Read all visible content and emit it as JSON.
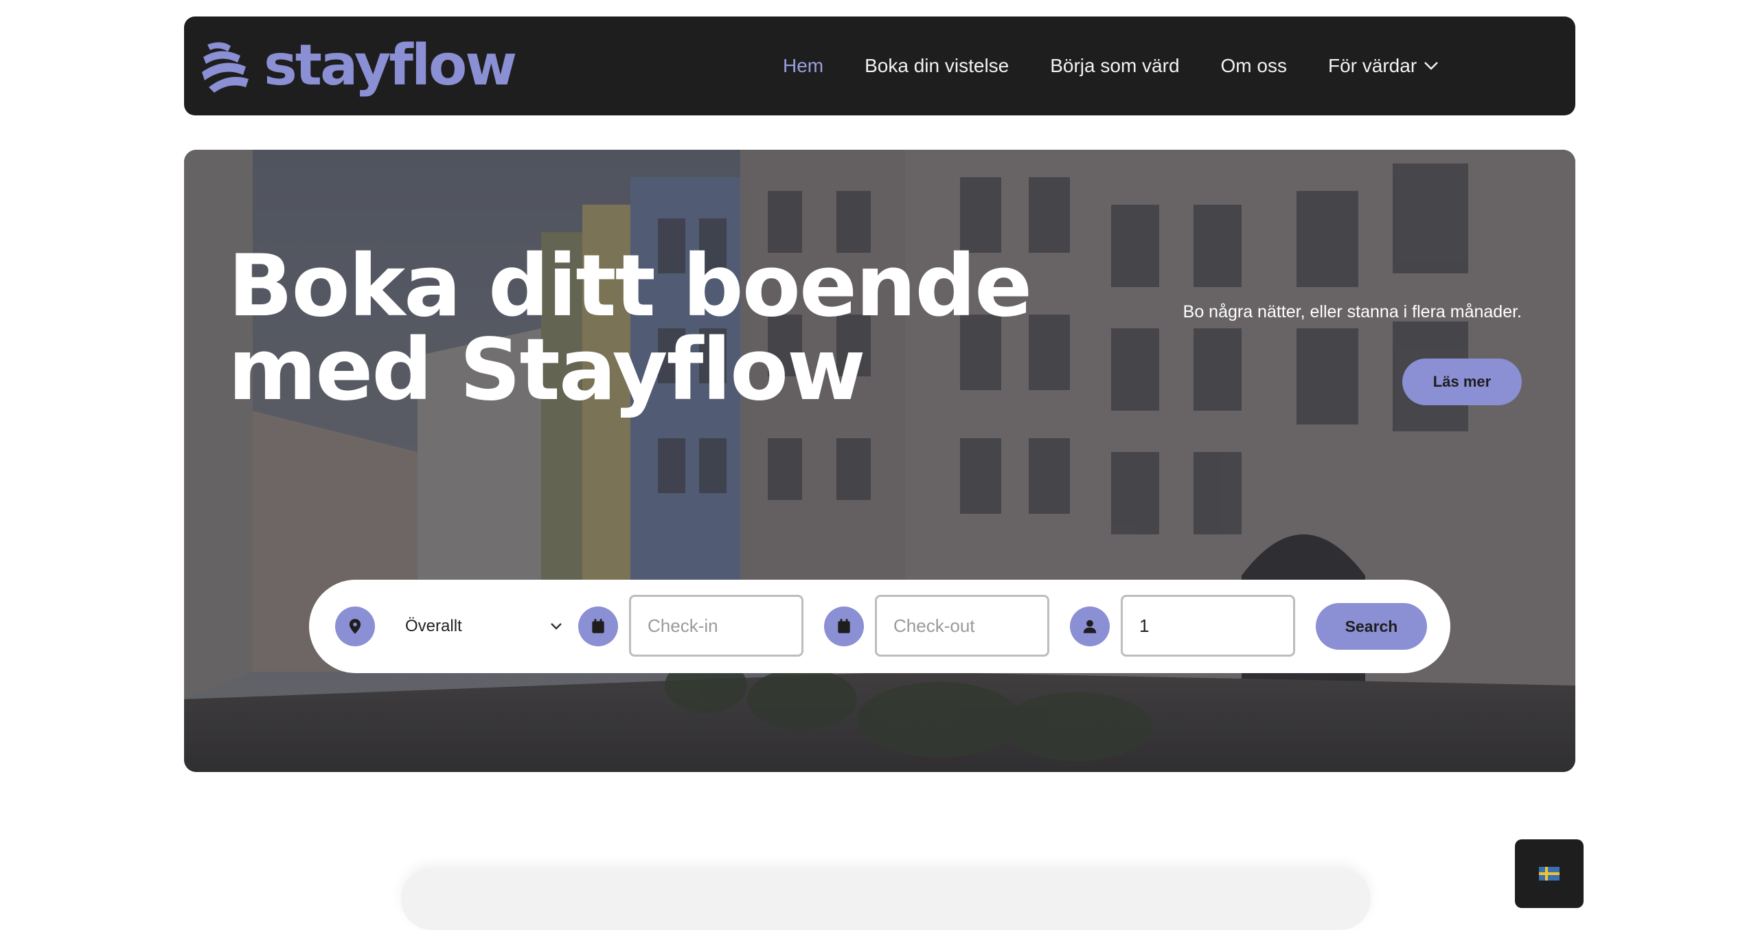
{
  "header": {
    "logo_text": "stayflow",
    "nav": [
      {
        "label": "Hem",
        "active": true
      },
      {
        "label": "Boka din vistelse",
        "active": false
      },
      {
        "label": "Börja som värd",
        "active": false
      },
      {
        "label": "Om oss",
        "active": false
      },
      {
        "label": "För värdar",
        "active": false,
        "has_dropdown": true
      }
    ]
  },
  "hero": {
    "title_line1": "Boka ditt boende",
    "title_line2": "med Stayflow",
    "subtitle": "Bo några nätter, eller stanna i flera månader.",
    "read_more_label": "Läs mer"
  },
  "search": {
    "location_value": "Överallt",
    "checkin_placeholder": "Check-in",
    "checkout_placeholder": "Check-out",
    "guests_value": "1",
    "search_label": "Search",
    "icons": [
      "location-pin-icon",
      "calendar-icon",
      "calendar-icon",
      "person-icon"
    ]
  },
  "language": {
    "current": "sv",
    "flag": "sweden-flag-icon"
  },
  "colors": {
    "accent": "#8b8fd3",
    "header_bg": "#1e1e1e",
    "nav_active": "#9a9ee0"
  }
}
